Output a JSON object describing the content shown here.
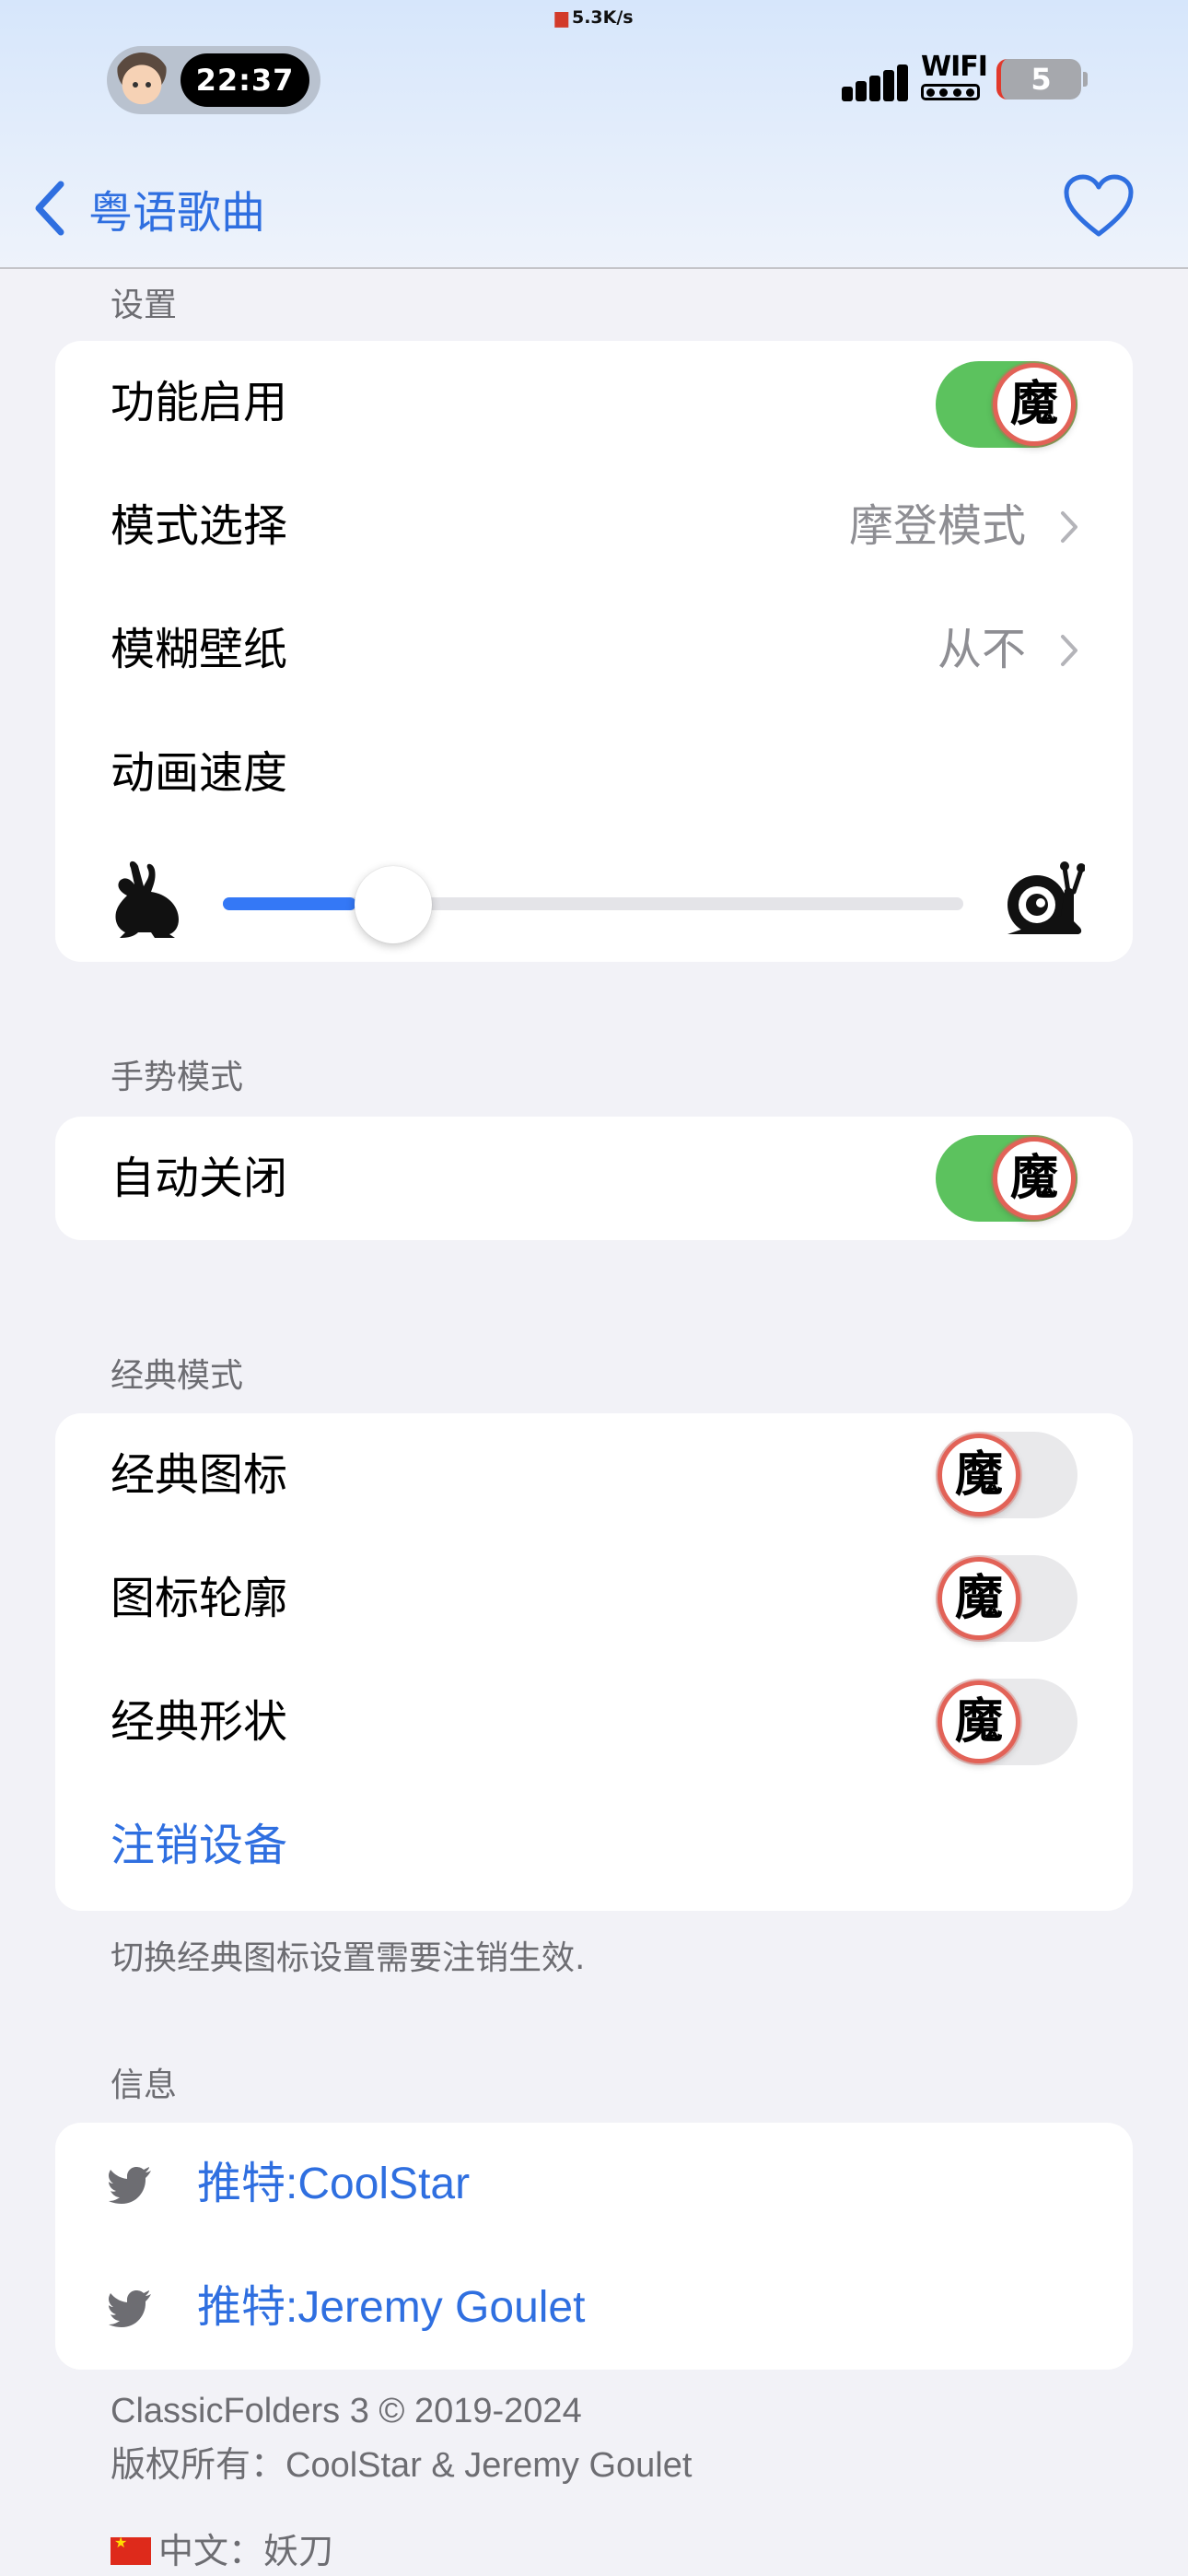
{
  "status_bar": {
    "net_speed": "5.3K/s",
    "time": "22:37",
    "wifi_label": "WIFI",
    "battery": "5"
  },
  "nav": {
    "back_label": "粤语歌曲",
    "favorite_icon": "heart-outline"
  },
  "settings": {
    "header": "设置",
    "enable_label": "功能启用",
    "enable_on": true,
    "mode_label": "模式选择",
    "mode_value": "摩登模式",
    "blur_label": "模糊壁纸",
    "blur_value": "从不",
    "speed_label": "动画速度",
    "speed_level": 0.18,
    "knob_glyph": "魔"
  },
  "gesture": {
    "header": "手势模式",
    "auto_close_label": "自动关闭",
    "auto_close_on": true
  },
  "classic": {
    "header": "经典模式",
    "icons_label": "经典图标",
    "icons_on": false,
    "outline_label": "图标轮廓",
    "outline_on": false,
    "shape_label": "经典形状",
    "shape_on": false,
    "logout_label": "注销设备",
    "footnote": "切换经典图标设置需要注销生效."
  },
  "info": {
    "header": "信息",
    "twitter1": "推特:CoolStar",
    "twitter2": "推特:Jeremy Goulet"
  },
  "footer": {
    "copyright": "ClassicFolders 3 © 2019-2024",
    "rights": "版权所有：CoolStar & Jeremy Goulet",
    "translator": "中文：妖刀"
  },
  "colors": {
    "accent": "#2f6fe0",
    "toggle_on": "#5cc25e",
    "slider": "#3478f6",
    "background": "#f2f2f7"
  }
}
